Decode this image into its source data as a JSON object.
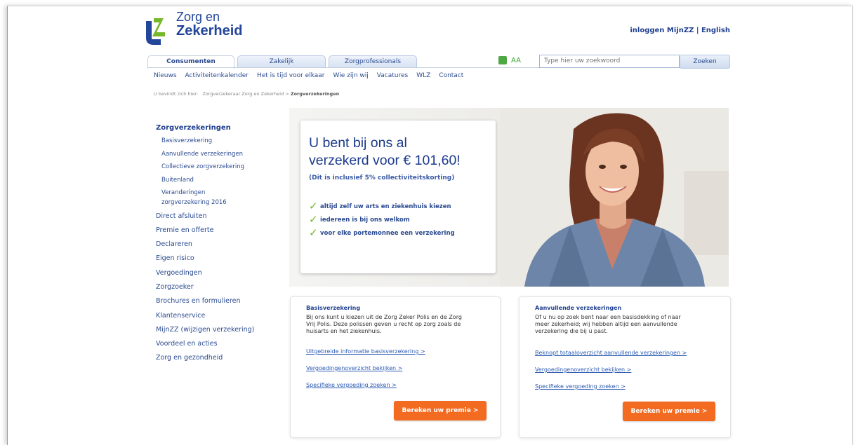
{
  "brand": {
    "name_line1": "Zorg en",
    "name_line2": "Zekerheid",
    "primary": "#1f3f8f",
    "accent_green": "#76b82a",
    "cta_orange": "#f26b21"
  },
  "header": {
    "login_label": "inloggen MijnZZ",
    "separator": "|",
    "language_label": "English"
  },
  "tabs": [
    {
      "label": "Consumenten",
      "active": true
    },
    {
      "label": "Zakelijk",
      "active": false
    },
    {
      "label": "Zorgprofessionals",
      "active": false
    }
  ],
  "tools": {
    "font_size_label": "AA"
  },
  "search": {
    "placeholder": "Type hier uw zoekwoord",
    "button_label": "Zoeken"
  },
  "subnav": [
    "Nieuws",
    "Activiteitenkalender",
    "Het is tijd voor elkaar",
    "Wie zijn wij",
    "Vacatures",
    "WLZ",
    "Contact"
  ],
  "breadcrumb": {
    "prefix": "U bevindt zich hier:",
    "home": "Zorgverzekeraar Zorg en Zekerheid",
    "sep": ">",
    "current": "Zorgverzekeringen"
  },
  "sidebar": {
    "heading": "Zorgverzekeringen",
    "sub_items": [
      "Basisverzekering",
      "Aanvullende verzekeringen",
      "Collectieve zorgverzekering",
      "Buitenland",
      "Veranderingen",
      "zorgverzekering 2016"
    ],
    "items": [
      "Direct afsluiten",
      "Premie en offerte",
      "Declareren",
      "Eigen risico",
      "Vergoedingen",
      "Zorgzoeker",
      "Brochures en formulieren",
      "Klantenservice",
      "MijnZZ (wijzigen verzekering)",
      "Voordeel en acties",
      "Zorg en gezondheid"
    ]
  },
  "hero": {
    "title_line1": "U bent bij ons al",
    "title_line2": "verzekerd voor € 101,60!",
    "subtitle": "(Dit is inclusief 5% collectiviteitskorting)",
    "checks": [
      "altijd zelf uw arts en ziekenhuis kiezen",
      "iedereen is bij ons welkom",
      "voor elke portemonnee een verzekering"
    ]
  },
  "boxes": [
    {
      "title": "Basisverzekering",
      "text_lines": [
        "Bij ons kunt u kiezen uit de Zorg Zeker Polis en de Zorg",
        "Vrij Polis. Deze polissen geven u recht op zorg zoals de",
        "huisarts en het ziekenhuis."
      ],
      "links": [
        "Uitgebreide informatie basisverzekering >",
        "Vergoedingenoverzicht bekijken >",
        "Specifieke vergoeding zoeken >"
      ],
      "cta": "Bereken uw premie >"
    },
    {
      "title": "Aanvullende verzekeringen",
      "text_lines": [
        "Of u nu op zoek bent naar een basisdekking of naar",
        "meer zekerheid; wij hebben altijd een aanvullende",
        "verzekering die bij u past."
      ],
      "links": [
        "Beknopt totaaloverzicht aanvullende verzekeringen >",
        "Vergoedingenoverzicht bekijken >",
        "Specifieke vergoeding zoeken >"
      ],
      "cta": "Bereken uw premie >"
    }
  ]
}
